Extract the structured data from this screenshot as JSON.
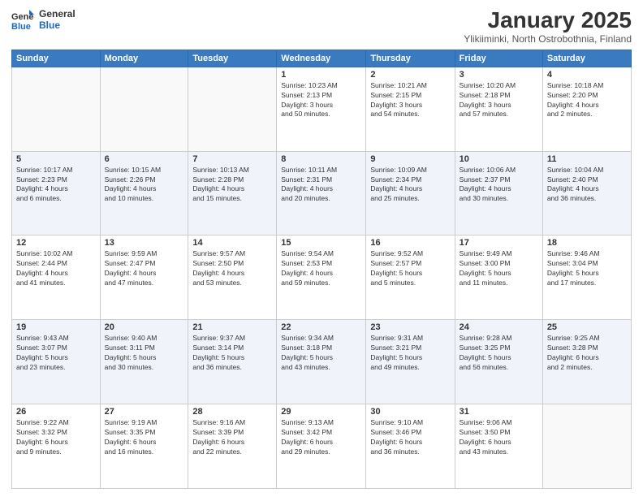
{
  "logo": {
    "line1": "General",
    "line2": "Blue"
  },
  "title": "January 2025",
  "subtitle": "Ylikiiminki, North Ostrobothnia, Finland",
  "days_of_week": [
    "Sunday",
    "Monday",
    "Tuesday",
    "Wednesday",
    "Thursday",
    "Friday",
    "Saturday"
  ],
  "weeks": [
    [
      {
        "day": "",
        "info": ""
      },
      {
        "day": "",
        "info": ""
      },
      {
        "day": "",
        "info": ""
      },
      {
        "day": "1",
        "info": "Sunrise: 10:23 AM\nSunset: 2:13 PM\nDaylight: 3 hours\nand 50 minutes."
      },
      {
        "day": "2",
        "info": "Sunrise: 10:21 AM\nSunset: 2:15 PM\nDaylight: 3 hours\nand 54 minutes."
      },
      {
        "day": "3",
        "info": "Sunrise: 10:20 AM\nSunset: 2:18 PM\nDaylight: 3 hours\nand 57 minutes."
      },
      {
        "day": "4",
        "info": "Sunrise: 10:18 AM\nSunset: 2:20 PM\nDaylight: 4 hours\nand 2 minutes."
      }
    ],
    [
      {
        "day": "5",
        "info": "Sunrise: 10:17 AM\nSunset: 2:23 PM\nDaylight: 4 hours\nand 6 minutes."
      },
      {
        "day": "6",
        "info": "Sunrise: 10:15 AM\nSunset: 2:26 PM\nDaylight: 4 hours\nand 10 minutes."
      },
      {
        "day": "7",
        "info": "Sunrise: 10:13 AM\nSunset: 2:28 PM\nDaylight: 4 hours\nand 15 minutes."
      },
      {
        "day": "8",
        "info": "Sunrise: 10:11 AM\nSunset: 2:31 PM\nDaylight: 4 hours\nand 20 minutes."
      },
      {
        "day": "9",
        "info": "Sunrise: 10:09 AM\nSunset: 2:34 PM\nDaylight: 4 hours\nand 25 minutes."
      },
      {
        "day": "10",
        "info": "Sunrise: 10:06 AM\nSunset: 2:37 PM\nDaylight: 4 hours\nand 30 minutes."
      },
      {
        "day": "11",
        "info": "Sunrise: 10:04 AM\nSunset: 2:40 PM\nDaylight: 4 hours\nand 36 minutes."
      }
    ],
    [
      {
        "day": "12",
        "info": "Sunrise: 10:02 AM\nSunset: 2:44 PM\nDaylight: 4 hours\nand 41 minutes."
      },
      {
        "day": "13",
        "info": "Sunrise: 9:59 AM\nSunset: 2:47 PM\nDaylight: 4 hours\nand 47 minutes."
      },
      {
        "day": "14",
        "info": "Sunrise: 9:57 AM\nSunset: 2:50 PM\nDaylight: 4 hours\nand 53 minutes."
      },
      {
        "day": "15",
        "info": "Sunrise: 9:54 AM\nSunset: 2:53 PM\nDaylight: 4 hours\nand 59 minutes."
      },
      {
        "day": "16",
        "info": "Sunrise: 9:52 AM\nSunset: 2:57 PM\nDaylight: 5 hours\nand 5 minutes."
      },
      {
        "day": "17",
        "info": "Sunrise: 9:49 AM\nSunset: 3:00 PM\nDaylight: 5 hours\nand 11 minutes."
      },
      {
        "day": "18",
        "info": "Sunrise: 9:46 AM\nSunset: 3:04 PM\nDaylight: 5 hours\nand 17 minutes."
      }
    ],
    [
      {
        "day": "19",
        "info": "Sunrise: 9:43 AM\nSunset: 3:07 PM\nDaylight: 5 hours\nand 23 minutes."
      },
      {
        "day": "20",
        "info": "Sunrise: 9:40 AM\nSunset: 3:11 PM\nDaylight: 5 hours\nand 30 minutes."
      },
      {
        "day": "21",
        "info": "Sunrise: 9:37 AM\nSunset: 3:14 PM\nDaylight: 5 hours\nand 36 minutes."
      },
      {
        "day": "22",
        "info": "Sunrise: 9:34 AM\nSunset: 3:18 PM\nDaylight: 5 hours\nand 43 minutes."
      },
      {
        "day": "23",
        "info": "Sunrise: 9:31 AM\nSunset: 3:21 PM\nDaylight: 5 hours\nand 49 minutes."
      },
      {
        "day": "24",
        "info": "Sunrise: 9:28 AM\nSunset: 3:25 PM\nDaylight: 5 hours\nand 56 minutes."
      },
      {
        "day": "25",
        "info": "Sunrise: 9:25 AM\nSunset: 3:28 PM\nDaylight: 6 hours\nand 2 minutes."
      }
    ],
    [
      {
        "day": "26",
        "info": "Sunrise: 9:22 AM\nSunset: 3:32 PM\nDaylight: 6 hours\nand 9 minutes."
      },
      {
        "day": "27",
        "info": "Sunrise: 9:19 AM\nSunset: 3:35 PM\nDaylight: 6 hours\nand 16 minutes."
      },
      {
        "day": "28",
        "info": "Sunrise: 9:16 AM\nSunset: 3:39 PM\nDaylight: 6 hours\nand 22 minutes."
      },
      {
        "day": "29",
        "info": "Sunrise: 9:13 AM\nSunset: 3:42 PM\nDaylight: 6 hours\nand 29 minutes."
      },
      {
        "day": "30",
        "info": "Sunrise: 9:10 AM\nSunset: 3:46 PM\nDaylight: 6 hours\nand 36 minutes."
      },
      {
        "day": "31",
        "info": "Sunrise: 9:06 AM\nSunset: 3:50 PM\nDaylight: 6 hours\nand 43 minutes."
      },
      {
        "day": "",
        "info": ""
      }
    ]
  ]
}
